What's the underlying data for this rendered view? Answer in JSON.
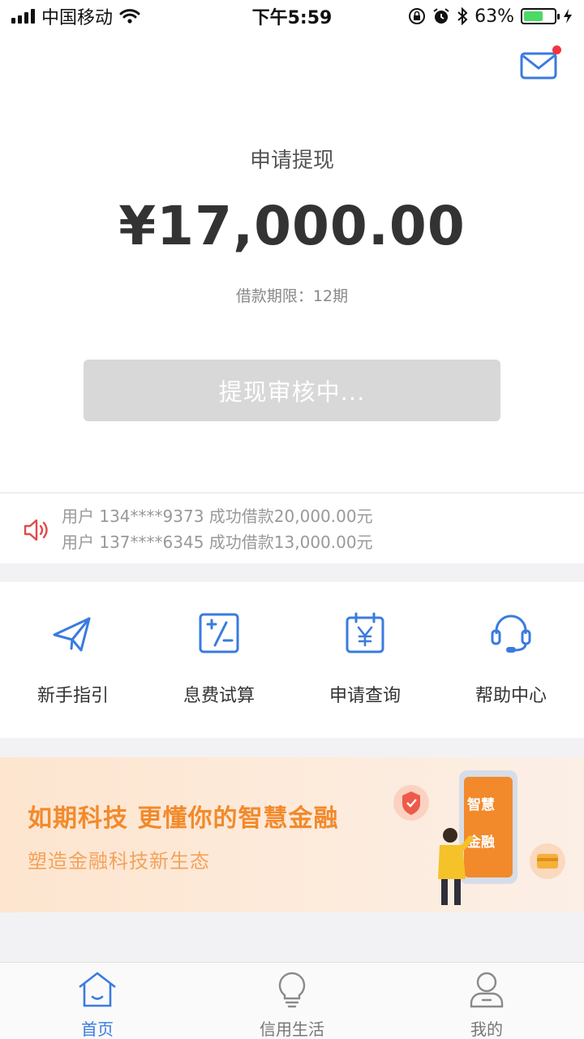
{
  "status_bar": {
    "carrier": "中国移动",
    "time": "下午5:59",
    "battery_percent": "63%",
    "battery_level": 0.63,
    "icons": [
      "signal-icon",
      "wifi-icon",
      "lock-rotation-icon",
      "alarm-icon",
      "bluetooth-icon",
      "battery-icon",
      "charging-icon"
    ]
  },
  "hero": {
    "title": "申请提现",
    "amount": "¥17,000.00",
    "term": "借款期限：12期",
    "status_button": "提现审核中...",
    "mail_icon": "mail-icon",
    "has_unread": true
  },
  "ticker": {
    "icon": "speaker-icon",
    "lines": [
      "用户 134****9373 成功借款20,000.00元",
      "用户 137****6345 成功借款13,000.00元"
    ]
  },
  "menu": {
    "items": [
      {
        "label": "新手指引",
        "icon": "paper-plane-icon"
      },
      {
        "label": "息费试算",
        "icon": "calculator-icon"
      },
      {
        "label": "申请查询",
        "icon": "calendar-yen-icon"
      },
      {
        "label": "帮助中心",
        "icon": "headset-icon"
      }
    ]
  },
  "banner": {
    "title": "如期科技 更懂你的智慧金融",
    "subtitle": "塑造金融科技新生态",
    "phone_text": [
      "智慧",
      "金融"
    ]
  },
  "tabbar": {
    "tabs": [
      {
        "label": "首页",
        "icon": "home-icon",
        "active": true
      },
      {
        "label": "信用生活",
        "icon": "lightbulb-icon",
        "active": false
      },
      {
        "label": "我的",
        "icon": "user-icon",
        "active": false
      }
    ]
  },
  "colors": {
    "accent_blue": "#3a7be0",
    "banner_orange": "#f28a2c",
    "badge_red": "#f5333f",
    "disabled_button": "#d8d8d8"
  }
}
